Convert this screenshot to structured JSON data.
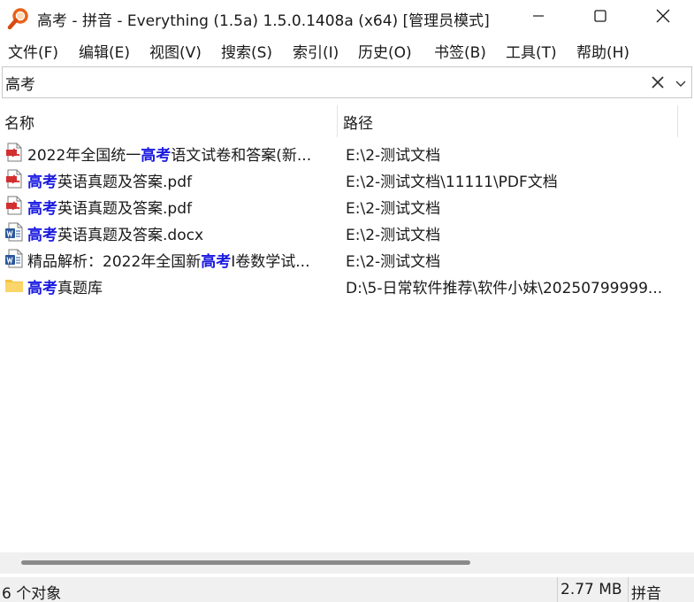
{
  "window": {
    "title": "高考 - 拼音 - Everything (1.5a) 1.5.0.1408a (x64) [管理员模式]",
    "app_icon": "magnifier-icon",
    "controls": [
      "minimize-icon",
      "maximize-icon",
      "close-icon"
    ]
  },
  "menu": [
    "文件(F)",
    "编辑(E)",
    "视图(V)",
    "搜索(S)",
    "索引(I)",
    "历史(O)",
    "书签(B)",
    "工具(T)",
    "帮助(H)"
  ],
  "search": {
    "value": "高考",
    "clear_icon": "clear-x-icon",
    "dropdown_icon": "chevron-down-icon"
  },
  "columns": {
    "name": "名称",
    "path": "路径"
  },
  "results": [
    {
      "icon": "pdf-file-icon",
      "pre": "2022年全国统一",
      "hl": "高考",
      "post": "语文试卷和答案(新...",
      "path": "E:\\2-测试文档"
    },
    {
      "icon": "pdf-file-icon",
      "pre": "",
      "hl": "高考",
      "post": "英语真题及答案.pdf",
      "path": "E:\\2-测试文档\\11111\\PDF文档"
    },
    {
      "icon": "pdf-file-icon",
      "pre": "",
      "hl": "高考",
      "post": "英语真题及答案.pdf",
      "path": "E:\\2-测试文档"
    },
    {
      "icon": "word-file-icon",
      "pre": "",
      "hl": "高考",
      "post": "英语真题及答案.docx",
      "path": "E:\\2-测试文档"
    },
    {
      "icon": "word-file-icon",
      "pre": "精品解析：2022年全国新",
      "hl": "高考",
      "post": "I卷数学试...",
      "path": "E:\\2-测试文档"
    },
    {
      "icon": "folder-icon",
      "pre": "",
      "hl": "高考",
      "post": "真题库",
      "path": "D:\\5-日常软件推荐\\软件小妹\\20250799999..."
    }
  ],
  "status": {
    "count": "6 个对象",
    "size": "2.77 MB",
    "mode": "拼音"
  },
  "colors": {
    "highlight": "#1a1ae0",
    "statusbar": "#f0f0f0",
    "folder": "#f5c343"
  }
}
